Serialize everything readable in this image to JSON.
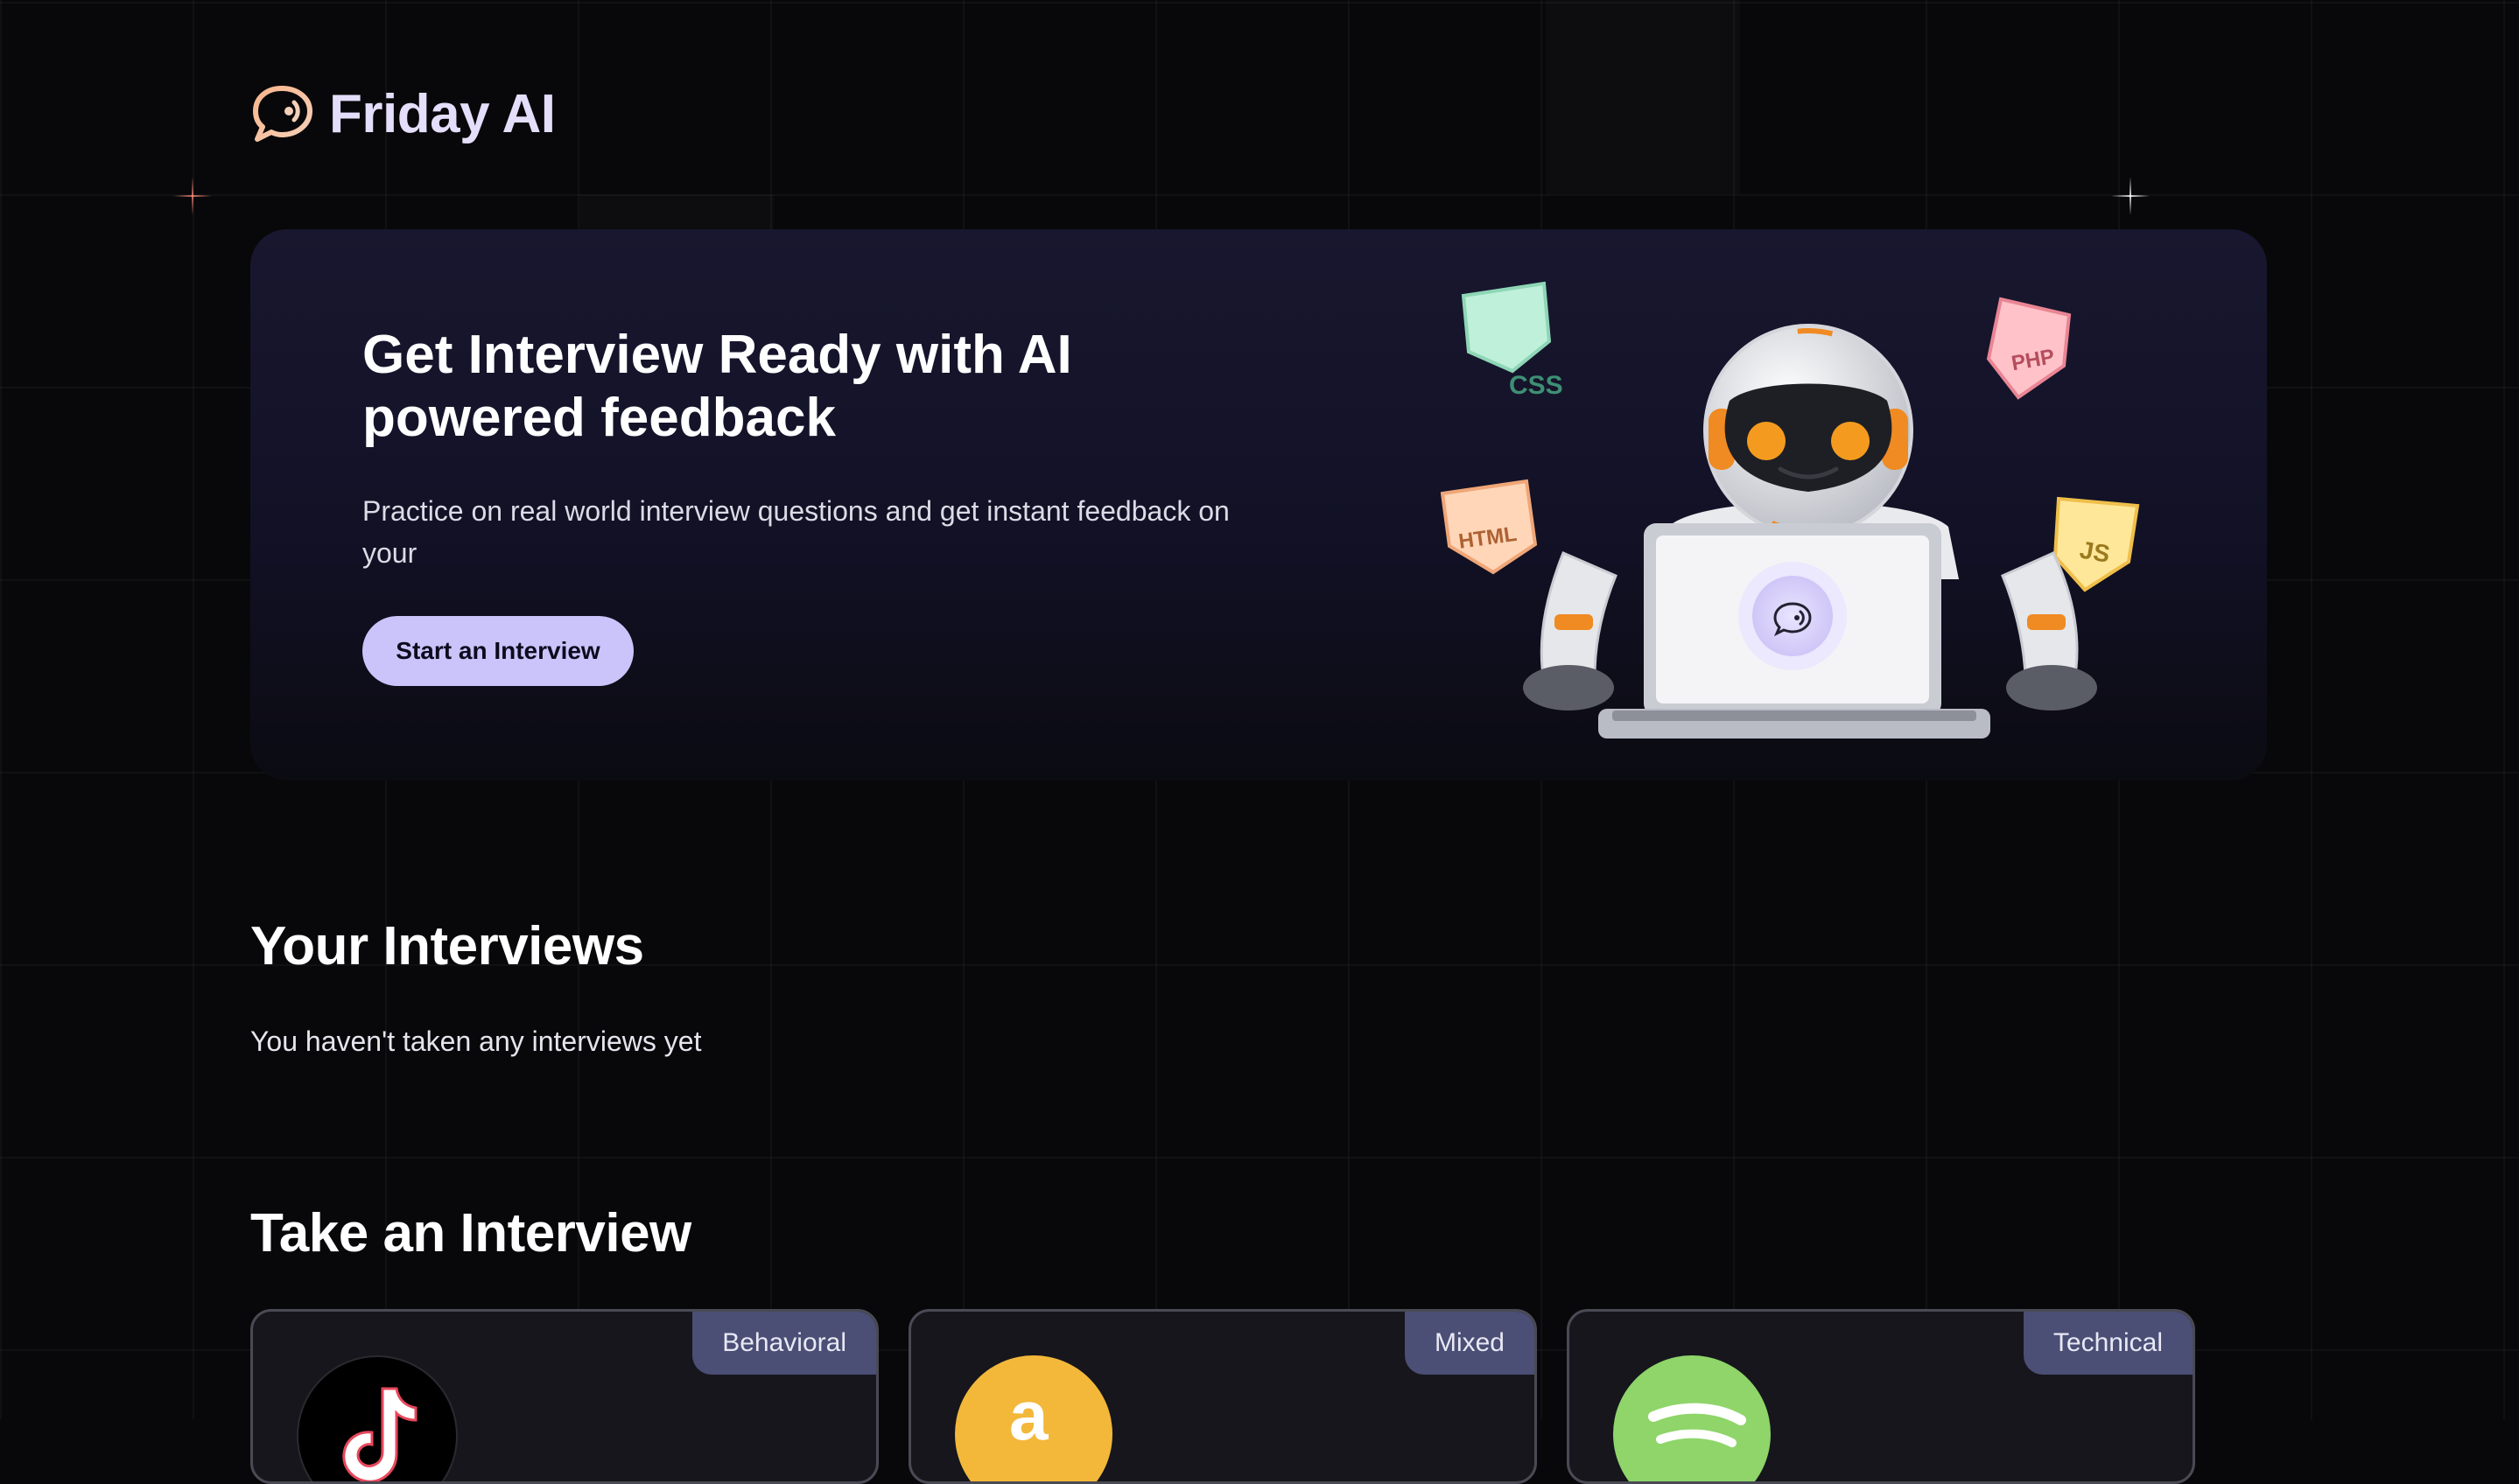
{
  "brand": {
    "name": "Friday AI"
  },
  "hero": {
    "title": "Get Interview Ready with AI powered feedback",
    "subtitle": "Practice on real world interview questions and get instant feedback on your",
    "cta_label": "Start an Interview",
    "badges": [
      "CSS",
      "PHP",
      "HTML",
      "JS"
    ]
  },
  "your_interviews": {
    "title": "Your Interviews",
    "empty_message": "You haven't taken any interviews yet"
  },
  "take_interview": {
    "title": "Take an Interview",
    "cards": [
      {
        "tag": "Behavioral",
        "logo": "tiktok-logo",
        "logo_color": "#000000"
      },
      {
        "tag": "Mixed",
        "logo": "amazon-logo",
        "logo_color": "#f3b83a"
      },
      {
        "tag": "Technical",
        "logo": "spotify-logo",
        "logo_color": "#8fd56a"
      }
    ]
  },
  "colors": {
    "background": "#08080a",
    "accent": "#cbc4fb",
    "hero_bg": "#16152c",
    "tag_bg": "#4b4e75"
  }
}
